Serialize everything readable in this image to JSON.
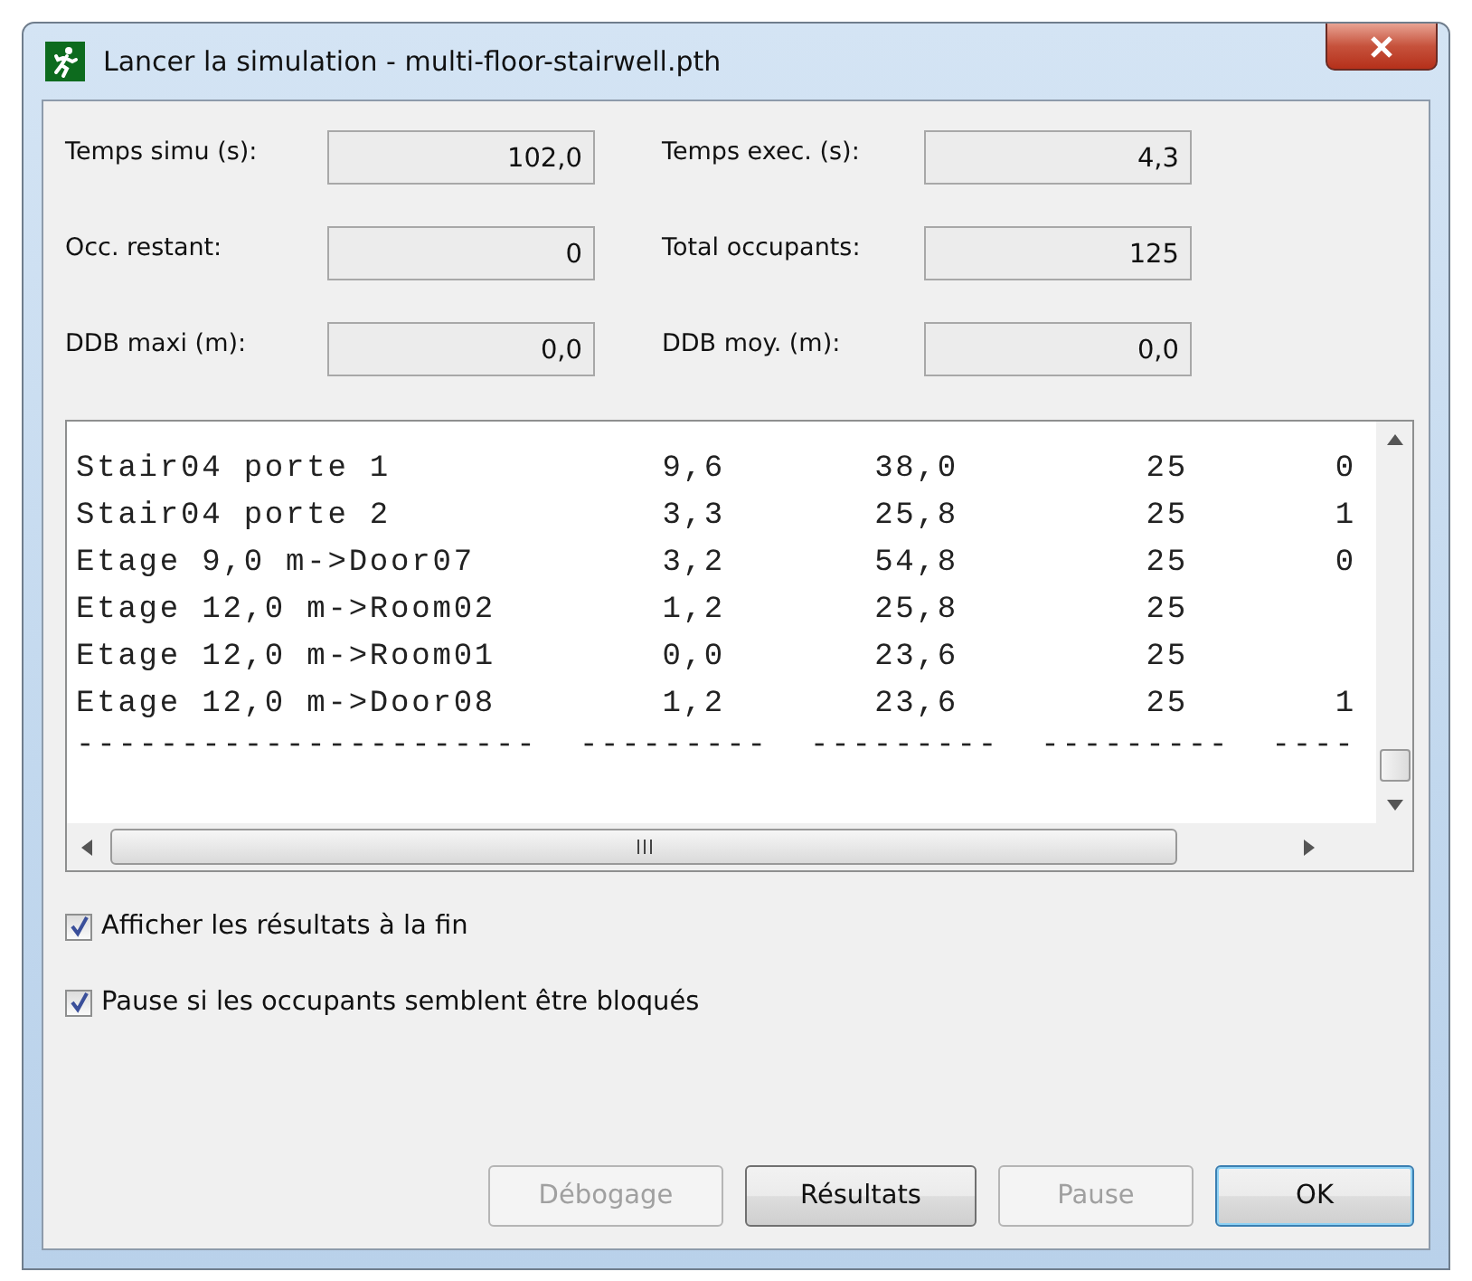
{
  "window": {
    "title": "Lancer la simulation - multi-floor-stairwell.pth"
  },
  "fields": [
    {
      "label": "Temps simu (s):",
      "value": "102,0"
    },
    {
      "label": "Temps exec. (s):",
      "value": "4,3"
    },
    {
      "label": "Occ. restant:",
      "value": "0"
    },
    {
      "label": "Total occupants:",
      "value": "125"
    },
    {
      "label": "DDB maxi (m):",
      "value": "0,0"
    },
    {
      "label": "DDB moy. (m):",
      "value": "0,0"
    }
  ],
  "log": {
    "rows": [
      {
        "cells": [
          "Stair04 porte 1",
          "9,6",
          "38,0",
          "25",
          "0"
        ]
      },
      {
        "cells": [
          "Stair04 porte 2",
          "3,3",
          "25,8",
          "25",
          "1"
        ]
      },
      {
        "cells": [
          "Etage 9,0 m->Door07",
          "3,2",
          "54,8",
          "25",
          "0"
        ]
      },
      {
        "cells": [
          "Etage 12,0 m->Room02",
          "1,2",
          "25,8",
          "25"
        ]
      },
      {
        "cells": [
          "Etage 12,0 m->Room01",
          "0,0",
          "23,6",
          "25"
        ]
      },
      {
        "cells": [
          "Etage 12,0 m->Door08",
          "1,2",
          "23,6",
          "25",
          "1"
        ]
      }
    ],
    "separator": "----------------------  ---------  ---------  ---------  ----"
  },
  "options": [
    {
      "label": "Afficher les résultats à la fin",
      "checked": true
    },
    {
      "label": "Pause si les occupants semblent être bloqués",
      "checked": true
    }
  ],
  "buttons": [
    {
      "label": "Débogage",
      "disabled": true,
      "focused": false
    },
    {
      "label": "Résultats",
      "disabled": false,
      "focused": false
    },
    {
      "label": "Pause",
      "disabled": true,
      "focused": false
    },
    {
      "label": "OK",
      "disabled": false,
      "focused": true
    }
  ]
}
